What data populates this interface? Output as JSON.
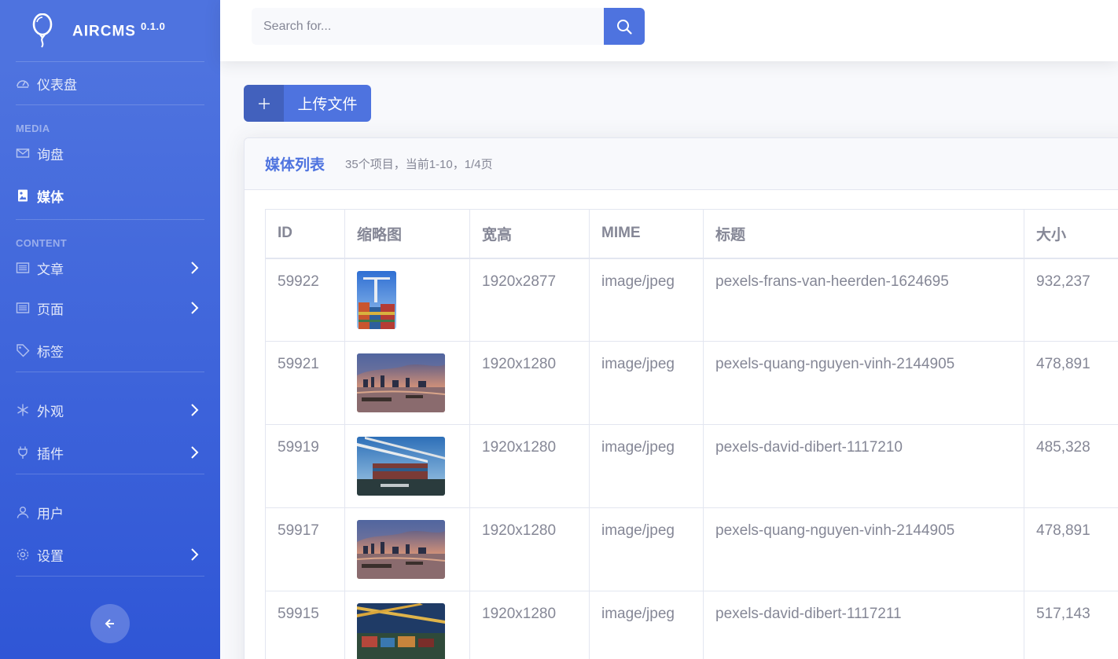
{
  "brand": {
    "name": "AIRCMS",
    "version": "0.1.0"
  },
  "sidebar": {
    "dashboard": "仪表盘",
    "sections": {
      "media": "MEDIA",
      "content": "CONTENT"
    },
    "items": {
      "inquiry": "询盘",
      "media": "媒体",
      "articles": "文章",
      "pages": "页面",
      "tags": "标签",
      "appearance": "外观",
      "plugins": "插件",
      "users": "用户",
      "settings": "设置"
    }
  },
  "search": {
    "placeholder": "Search for..."
  },
  "upload": {
    "label": "上传文件"
  },
  "card": {
    "title": "媒体列表",
    "subtitle": "35个项目，当前1-10，1/4页"
  },
  "table": {
    "headers": [
      "ID",
      "缩略图",
      "宽高",
      "MIME",
      "标题",
      "大小"
    ],
    "rows": [
      {
        "id": "59922",
        "dims": "1920x2877",
        "mime": "image/jpeg",
        "title": "pexels-frans-van-heerden-1624695",
        "size": "932,237",
        "thumb": "containers-crane-portrait"
      },
      {
        "id": "59921",
        "dims": "1920x1280",
        "mime": "image/jpeg",
        "title": "pexels-quang-nguyen-vinh-2144905",
        "size": "478,891",
        "thumb": "river-city-sunset"
      },
      {
        "id": "59919",
        "dims": "1920x1280",
        "mime": "image/jpeg",
        "title": "pexels-david-dibert-1117210",
        "size": "485,328",
        "thumb": "container-ship-evergreen"
      },
      {
        "id": "59917",
        "dims": "1920x1280",
        "mime": "image/jpeg",
        "title": "pexels-quang-nguyen-vinh-2144905",
        "size": "478,891",
        "thumb": "river-city-sunset"
      },
      {
        "id": "59915",
        "dims": "1920x1280",
        "mime": "image/jpeg",
        "title": "pexels-david-dibert-1117211",
        "size": "517,143",
        "thumb": "port-cranes-night"
      }
    ]
  },
  "colors": {
    "primary": "#4e73df",
    "text": "#858796",
    "border": "#e3e6f0"
  }
}
